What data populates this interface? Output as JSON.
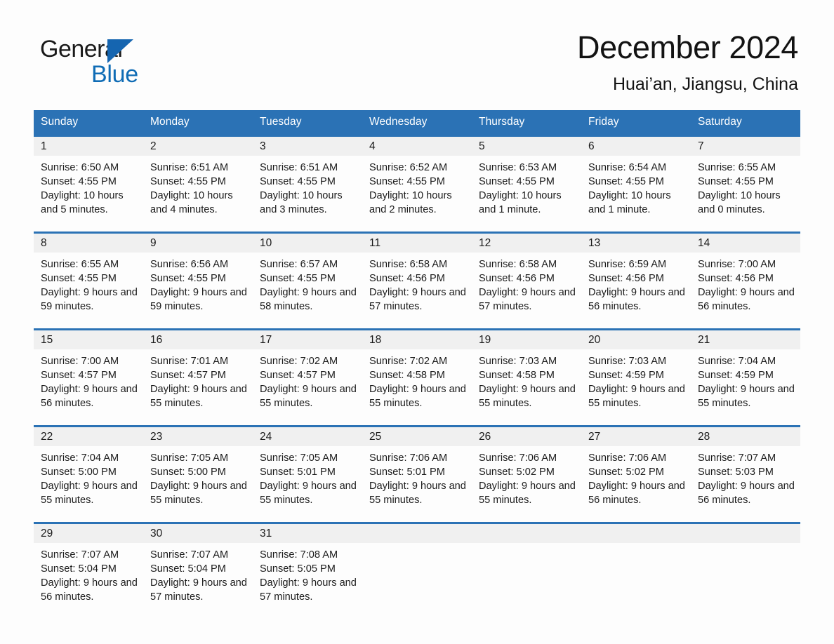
{
  "brand": {
    "name_part1": "General",
    "name_part2": "Blue"
  },
  "header": {
    "month_title": "December 2024",
    "location": "Huai’an, Jiangsu, China"
  },
  "colors": {
    "header_blue": "#2b72b5",
    "row_rule_blue": "#2b72b5",
    "daynum_band": "#f0f0f0",
    "logo_blue": "#0f6cb5",
    "page_background": "#fdfdfd",
    "text": "#1b1b1b"
  },
  "calendar": {
    "weekday_headers": [
      "Sunday",
      "Monday",
      "Tuesday",
      "Wednesday",
      "Thursday",
      "Friday",
      "Saturday"
    ],
    "weeks": [
      [
        {
          "day": "1",
          "sunrise": "Sunrise: 6:50 AM",
          "sunset": "Sunset: 4:55 PM",
          "daylight": "Daylight: 10 hours and 5 minutes."
        },
        {
          "day": "2",
          "sunrise": "Sunrise: 6:51 AM",
          "sunset": "Sunset: 4:55 PM",
          "daylight": "Daylight: 10 hours and 4 minutes."
        },
        {
          "day": "3",
          "sunrise": "Sunrise: 6:51 AM",
          "sunset": "Sunset: 4:55 PM",
          "daylight": "Daylight: 10 hours and 3 minutes."
        },
        {
          "day": "4",
          "sunrise": "Sunrise: 6:52 AM",
          "sunset": "Sunset: 4:55 PM",
          "daylight": "Daylight: 10 hours and 2 minutes."
        },
        {
          "day": "5",
          "sunrise": "Sunrise: 6:53 AM",
          "sunset": "Sunset: 4:55 PM",
          "daylight": "Daylight: 10 hours and 1 minute."
        },
        {
          "day": "6",
          "sunrise": "Sunrise: 6:54 AM",
          "sunset": "Sunset: 4:55 PM",
          "daylight": "Daylight: 10 hours and 1 minute."
        },
        {
          "day": "7",
          "sunrise": "Sunrise: 6:55 AM",
          "sunset": "Sunset: 4:55 PM",
          "daylight": "Daylight: 10 hours and 0 minutes."
        }
      ],
      [
        {
          "day": "8",
          "sunrise": "Sunrise: 6:55 AM",
          "sunset": "Sunset: 4:55 PM",
          "daylight": "Daylight: 9 hours and 59 minutes."
        },
        {
          "day": "9",
          "sunrise": "Sunrise: 6:56 AM",
          "sunset": "Sunset: 4:55 PM",
          "daylight": "Daylight: 9 hours and 59 minutes."
        },
        {
          "day": "10",
          "sunrise": "Sunrise: 6:57 AM",
          "sunset": "Sunset: 4:55 PM",
          "daylight": "Daylight: 9 hours and 58 minutes."
        },
        {
          "day": "11",
          "sunrise": "Sunrise: 6:58 AM",
          "sunset": "Sunset: 4:56 PM",
          "daylight": "Daylight: 9 hours and 57 minutes."
        },
        {
          "day": "12",
          "sunrise": "Sunrise: 6:58 AM",
          "sunset": "Sunset: 4:56 PM",
          "daylight": "Daylight: 9 hours and 57 minutes."
        },
        {
          "day": "13",
          "sunrise": "Sunrise: 6:59 AM",
          "sunset": "Sunset: 4:56 PM",
          "daylight": "Daylight: 9 hours and 56 minutes."
        },
        {
          "day": "14",
          "sunrise": "Sunrise: 7:00 AM",
          "sunset": "Sunset: 4:56 PM",
          "daylight": "Daylight: 9 hours and 56 minutes."
        }
      ],
      [
        {
          "day": "15",
          "sunrise": "Sunrise: 7:00 AM",
          "sunset": "Sunset: 4:57 PM",
          "daylight": "Daylight: 9 hours and 56 minutes."
        },
        {
          "day": "16",
          "sunrise": "Sunrise: 7:01 AM",
          "sunset": "Sunset: 4:57 PM",
          "daylight": "Daylight: 9 hours and 55 minutes."
        },
        {
          "day": "17",
          "sunrise": "Sunrise: 7:02 AM",
          "sunset": "Sunset: 4:57 PM",
          "daylight": "Daylight: 9 hours and 55 minutes."
        },
        {
          "day": "18",
          "sunrise": "Sunrise: 7:02 AM",
          "sunset": "Sunset: 4:58 PM",
          "daylight": "Daylight: 9 hours and 55 minutes."
        },
        {
          "day": "19",
          "sunrise": "Sunrise: 7:03 AM",
          "sunset": "Sunset: 4:58 PM",
          "daylight": "Daylight: 9 hours and 55 minutes."
        },
        {
          "day": "20",
          "sunrise": "Sunrise: 7:03 AM",
          "sunset": "Sunset: 4:59 PM",
          "daylight": "Daylight: 9 hours and 55 minutes."
        },
        {
          "day": "21",
          "sunrise": "Sunrise: 7:04 AM",
          "sunset": "Sunset: 4:59 PM",
          "daylight": "Daylight: 9 hours and 55 minutes."
        }
      ],
      [
        {
          "day": "22",
          "sunrise": "Sunrise: 7:04 AM",
          "sunset": "Sunset: 5:00 PM",
          "daylight": "Daylight: 9 hours and 55 minutes."
        },
        {
          "day": "23",
          "sunrise": "Sunrise: 7:05 AM",
          "sunset": "Sunset: 5:00 PM",
          "daylight": "Daylight: 9 hours and 55 minutes."
        },
        {
          "day": "24",
          "sunrise": "Sunrise: 7:05 AM",
          "sunset": "Sunset: 5:01 PM",
          "daylight": "Daylight: 9 hours and 55 minutes."
        },
        {
          "day": "25",
          "sunrise": "Sunrise: 7:06 AM",
          "sunset": "Sunset: 5:01 PM",
          "daylight": "Daylight: 9 hours and 55 minutes."
        },
        {
          "day": "26",
          "sunrise": "Sunrise: 7:06 AM",
          "sunset": "Sunset: 5:02 PM",
          "daylight": "Daylight: 9 hours and 55 minutes."
        },
        {
          "day": "27",
          "sunrise": "Sunrise: 7:06 AM",
          "sunset": "Sunset: 5:02 PM",
          "daylight": "Daylight: 9 hours and 56 minutes."
        },
        {
          "day": "28",
          "sunrise": "Sunrise: 7:07 AM",
          "sunset": "Sunset: 5:03 PM",
          "daylight": "Daylight: 9 hours and 56 minutes."
        }
      ],
      [
        {
          "day": "29",
          "sunrise": "Sunrise: 7:07 AM",
          "sunset": "Sunset: 5:04 PM",
          "daylight": "Daylight: 9 hours and 56 minutes."
        },
        {
          "day": "30",
          "sunrise": "Sunrise: 7:07 AM",
          "sunset": "Sunset: 5:04 PM",
          "daylight": "Daylight: 9 hours and 57 minutes."
        },
        {
          "day": "31",
          "sunrise": "Sunrise: 7:08 AM",
          "sunset": "Sunset: 5:05 PM",
          "daylight": "Daylight: 9 hours and 57 minutes."
        },
        {
          "day": "",
          "sunrise": "",
          "sunset": "",
          "daylight": ""
        },
        {
          "day": "",
          "sunrise": "",
          "sunset": "",
          "daylight": ""
        },
        {
          "day": "",
          "sunrise": "",
          "sunset": "",
          "daylight": ""
        },
        {
          "day": "",
          "sunrise": "",
          "sunset": "",
          "daylight": ""
        }
      ]
    ]
  }
}
